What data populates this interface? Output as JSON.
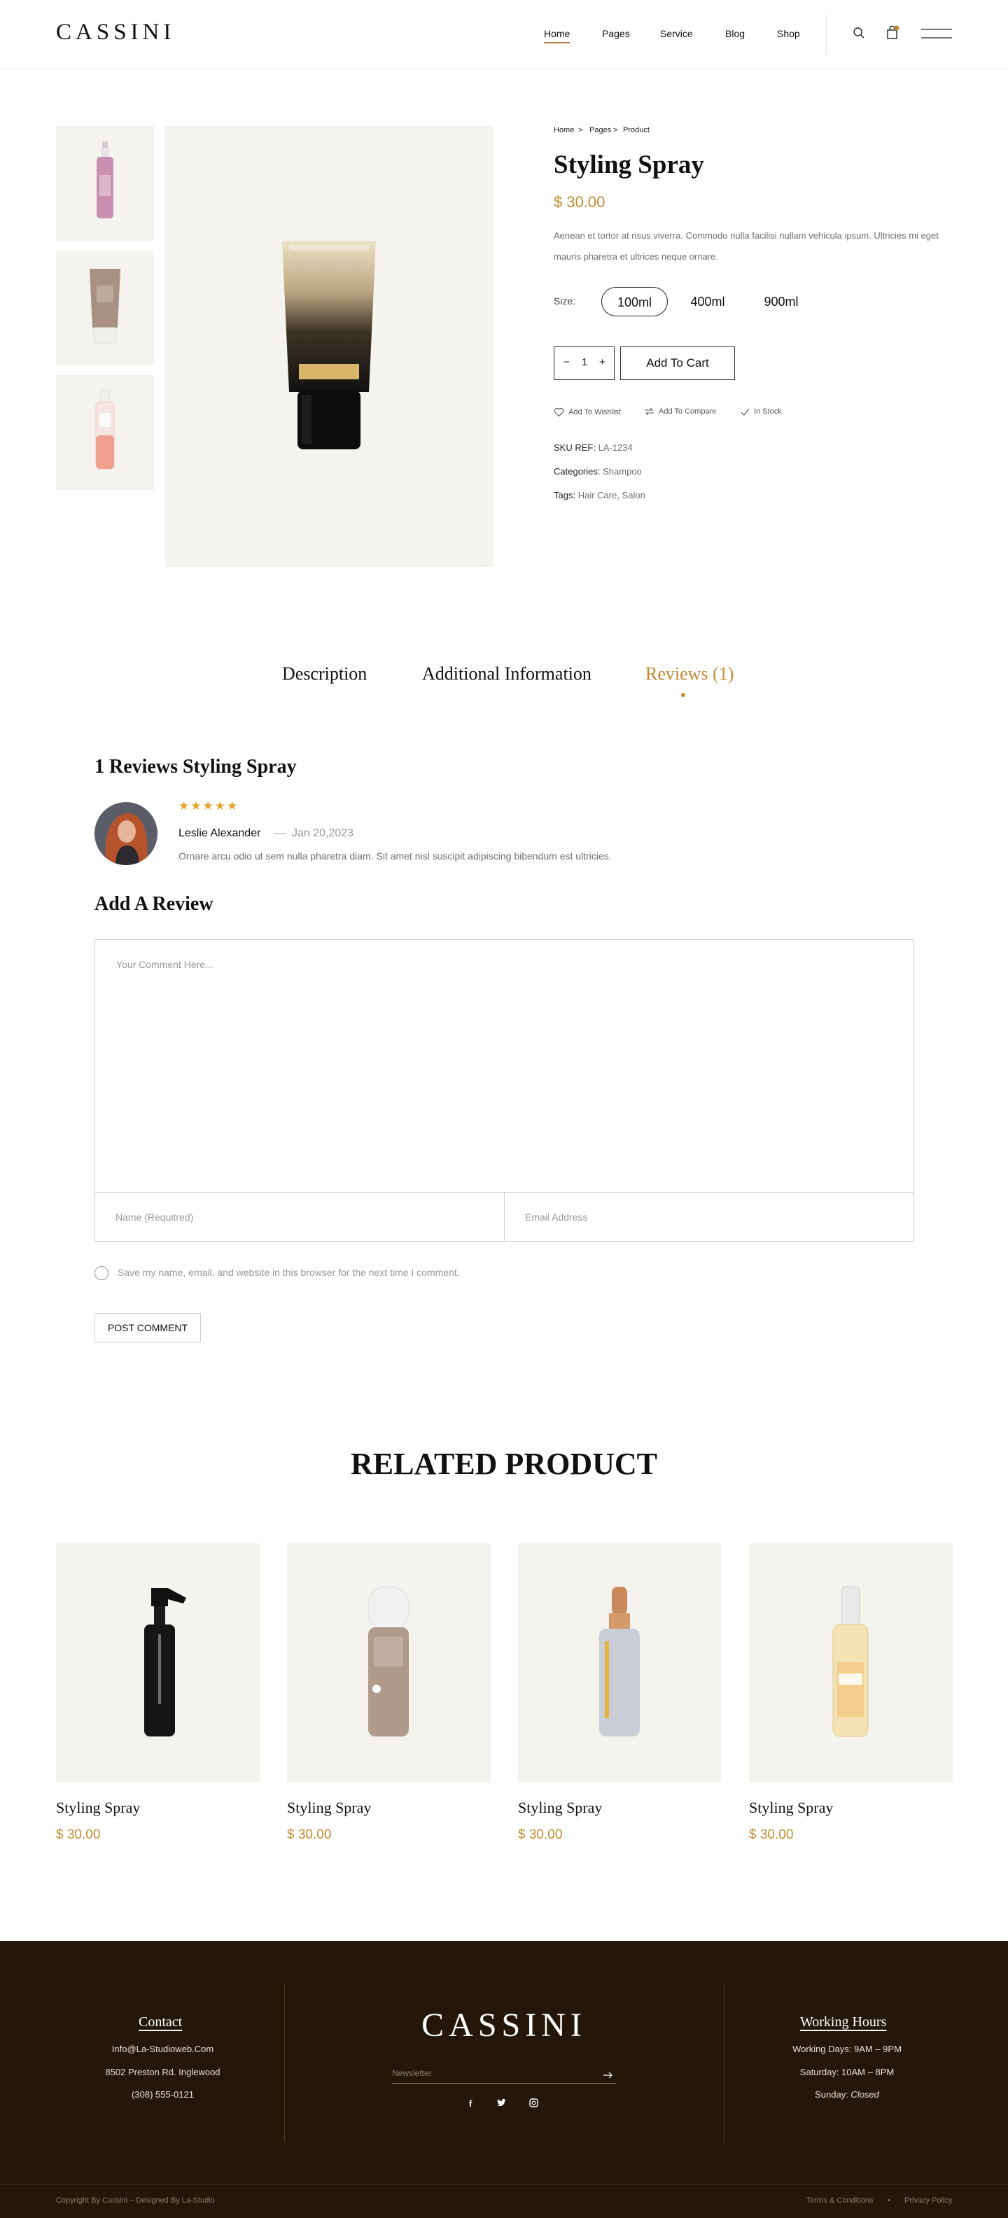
{
  "header": {
    "logo": "CASSINI",
    "nav": [
      {
        "label": "Home",
        "active": true
      },
      {
        "label": "Pages",
        "active": false
      },
      {
        "label": "Service",
        "active": false
      },
      {
        "label": "Blog",
        "active": false
      },
      {
        "label": "Shop",
        "active": false
      }
    ],
    "cart_badge_color": "#c48a2e"
  },
  "gallery": {
    "thumbnails": [
      "pink-serum-bottle",
      "taupe-cream-tube",
      "coral-spray-bottle"
    ],
    "main_image": "black-gold-hair-tube"
  },
  "product": {
    "breadcrumb": [
      "Home",
      "Pages",
      "Product"
    ],
    "breadcrumb_sep": ">",
    "title": "Styling Spray",
    "price": "$ 30.00",
    "description": "Aenean et tortor at risus viverra. Commodo nulla facilisi nullam vehicula ipsum. Ultricies mi eget mauris pharetra et ultrices neque ornare.",
    "size_label": "Size:",
    "sizes": [
      "100ml",
      "400ml",
      "900ml"
    ],
    "selected_size": "100ml",
    "quantity": "1",
    "qty_minus": "−",
    "qty_plus": "+",
    "add_to_cart": "Add To Cart",
    "actions": {
      "wishlist": "Add To Wishlist",
      "compare": "Add To Compare",
      "stock": "In Stock"
    },
    "sku_label": "SKU REF:",
    "sku_value": "LA-1234",
    "categories_label": "Categories:",
    "categories_value": "Shampoo",
    "tags_label": "Tags:",
    "tags_value": "Hair Care, Salon"
  },
  "tabs": [
    {
      "label": "Description",
      "active": false
    },
    {
      "label": "Additional Information",
      "active": false
    },
    {
      "label": "Reviews (1)",
      "active": true
    }
  ],
  "reviews": {
    "heading": "1 Reviews Styling Spray",
    "items": [
      {
        "rating": 5,
        "stars": "★★★★★",
        "name": "Leslie Alexander",
        "sep": "—",
        "date": "Jan 20,2023",
        "body": "Ornare arcu odio ut sem nulla pharetra diam. Sit amet nisl suscipit adipiscing bibendum est ultricies."
      }
    ]
  },
  "review_form": {
    "heading": "Add A Review",
    "comment_placeholder": "Your Comment Here...",
    "name_placeholder": "Name (Requitred)",
    "email_placeholder": "Email Address",
    "save_label": "Save my name, email, and website in this browser for the next time I comment.",
    "submit": "POST COMMENT"
  },
  "related": {
    "heading": "RELATED PRODUCT",
    "products": [
      {
        "name": "Styling Spray",
        "price": "$ 30.00",
        "image": "black-spray-bottle"
      },
      {
        "name": "Styling Spray",
        "price": "$ 30.00",
        "image": "taupe-spray-bottle"
      },
      {
        "name": "Styling Spray",
        "price": "$ 30.00",
        "image": "silver-dropper-bottle"
      },
      {
        "name": "Styling Spray",
        "price": "$ 30.00",
        "image": "gold-oil-bottle"
      }
    ]
  },
  "footer": {
    "contact_heading": "Contact",
    "contact_lines": [
      "Info@La-Studioweb.Com",
      "8502 Preston Rd. Inglewood",
      "(308) 555-0121"
    ],
    "logo": "CASSINI",
    "newsletter_placeholder": "Newsletter",
    "social": [
      "facebook-icon",
      "twitter-icon",
      "instagram-icon"
    ],
    "hours_heading": "Working Hours",
    "hours_lines": [
      "Working Days: 9AM – 9PM",
      "Saturday: 10AM – 8PM"
    ],
    "sunday_label": "Sunday:",
    "sunday_value": "Closed",
    "copyright": "Copyright By Cassini – Designed By La-Studio",
    "links": [
      "Terms & Conditions",
      "Privacy Policy"
    ],
    "link_sep": "•"
  },
  "colors": {
    "accent": "#c48a2e",
    "footer_bg": "#24170a",
    "panel_bg": "#f5f3ee"
  }
}
